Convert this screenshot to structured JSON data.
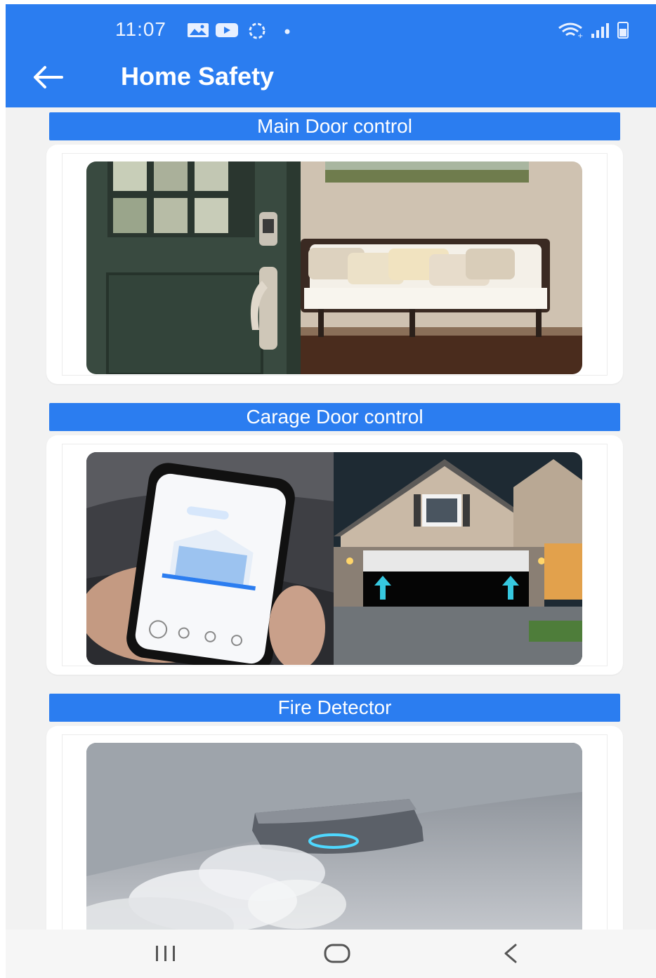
{
  "status_bar": {
    "time": "11:07",
    "left_icons": [
      "gallery-icon",
      "youtube-icon",
      "sync-icon",
      "dot-icon"
    ],
    "right_icons": [
      "wifi-icon",
      "signal-icon",
      "battery-icon"
    ]
  },
  "app_bar": {
    "back_icon": "arrow-left-icon",
    "title": "Home Safety"
  },
  "sections": [
    {
      "header": "Main Door control",
      "image": "front-door-smart-lock-photo"
    },
    {
      "header": "Carage Door control",
      "image": "garage-door-app-photo"
    },
    {
      "header": "Fire Detector",
      "image": "smoke-detector-photo"
    }
  ],
  "nav_bar": {
    "buttons": [
      "recent-apps-icon",
      "home-icon",
      "back-icon"
    ]
  },
  "colors": {
    "primary": "#2b7df0",
    "background": "#f2f2f2",
    "card": "#ffffff"
  }
}
